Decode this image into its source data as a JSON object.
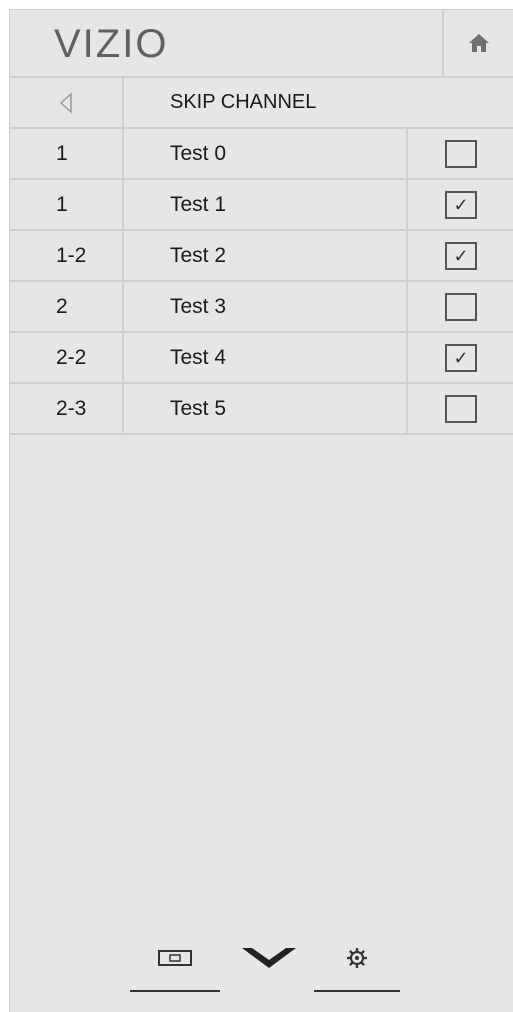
{
  "header": {
    "logo_text": "VIZIO",
    "home_icon": "home-icon"
  },
  "menu": {
    "back_icon": "back-arrow-icon",
    "title": "SKIP CHANNEL"
  },
  "channels": [
    {
      "number": "1",
      "name": "Test 0",
      "skipped": false
    },
    {
      "number": "1",
      "name": "Test 1",
      "skipped": true
    },
    {
      "number": "1-2",
      "name": "Test 2",
      "skipped": true
    },
    {
      "number": "2",
      "name": "Test 3",
      "skipped": false
    },
    {
      "number": "2-2",
      "name": "Test 4",
      "skipped": true
    },
    {
      "number": "2-3",
      "name": "Test 5",
      "skipped": false
    }
  ],
  "bottom_bar": {
    "items": [
      "input-icon",
      "chevron-down-icon",
      "settings-icon"
    ]
  },
  "colors": {
    "panel_bg": "#e6e6e6",
    "divider": "#d0d0d0",
    "text": "#1a1a1a",
    "logo": "#606060"
  }
}
